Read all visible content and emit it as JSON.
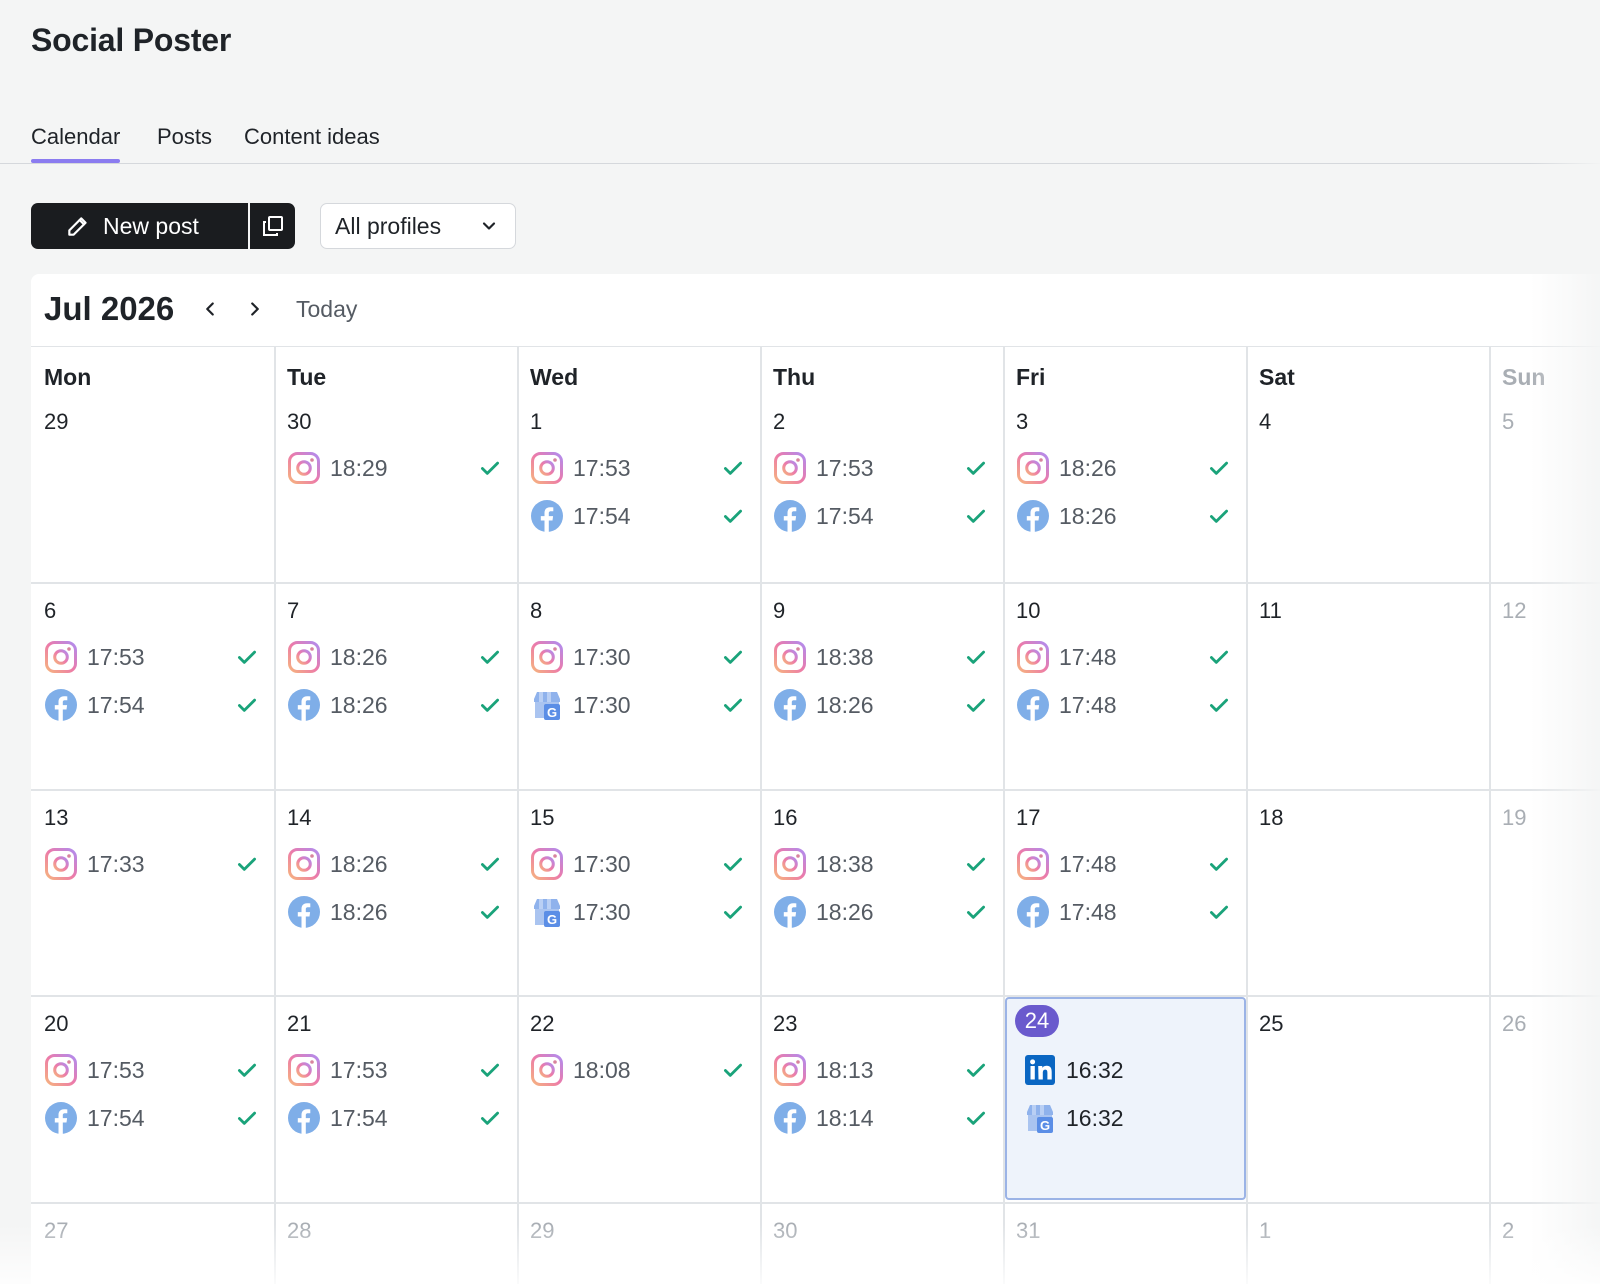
{
  "app": {
    "title": "Social Poster"
  },
  "tabs": [
    {
      "label": "Calendar",
      "active": true
    },
    {
      "label": "Posts",
      "active": false
    },
    {
      "label": "Content ideas",
      "active": false
    }
  ],
  "toolbar": {
    "new_post_label": "New post",
    "profiles_select": "All profiles"
  },
  "calendar": {
    "month_label": "Jul 2026",
    "today_label": "Today",
    "weekdays": [
      "Mon",
      "Tue",
      "Wed",
      "Thu",
      "Fri",
      "Sat",
      "Sun"
    ],
    "weeks": [
      [
        {
          "day": "29",
          "posts": []
        },
        {
          "day": "30",
          "posts": [
            {
              "network": "instagram",
              "time": "18:29",
              "status": "published"
            }
          ]
        },
        {
          "day": "1",
          "posts": [
            {
              "network": "instagram",
              "time": "17:53",
              "status": "published"
            },
            {
              "network": "facebook",
              "time": "17:54",
              "status": "published"
            }
          ]
        },
        {
          "day": "2",
          "posts": [
            {
              "network": "instagram",
              "time": "17:53",
              "status": "published"
            },
            {
              "network": "facebook",
              "time": "17:54",
              "status": "published"
            }
          ]
        },
        {
          "day": "3",
          "posts": [
            {
              "network": "instagram",
              "time": "18:26",
              "status": "published"
            },
            {
              "network": "facebook",
              "time": "18:26",
              "status": "published"
            }
          ]
        },
        {
          "day": "4",
          "posts": []
        },
        {
          "day": "5",
          "posts": []
        }
      ],
      [
        {
          "day": "6",
          "posts": [
            {
              "network": "instagram",
              "time": "17:53",
              "status": "published"
            },
            {
              "network": "facebook",
              "time": "17:54",
              "status": "published"
            }
          ]
        },
        {
          "day": "7",
          "posts": [
            {
              "network": "instagram",
              "time": "18:26",
              "status": "published"
            },
            {
              "network": "facebook",
              "time": "18:26",
              "status": "published"
            }
          ]
        },
        {
          "day": "8",
          "posts": [
            {
              "network": "instagram",
              "time": "17:30",
              "status": "published"
            },
            {
              "network": "google-business",
              "time": "17:30",
              "status": "published"
            }
          ]
        },
        {
          "day": "9",
          "posts": [
            {
              "network": "instagram",
              "time": "18:38",
              "status": "published"
            },
            {
              "network": "facebook",
              "time": "18:26",
              "status": "published"
            }
          ]
        },
        {
          "day": "10",
          "posts": [
            {
              "network": "instagram",
              "time": "17:48",
              "status": "published"
            },
            {
              "network": "facebook",
              "time": "17:48",
              "status": "published"
            }
          ]
        },
        {
          "day": "11",
          "posts": []
        },
        {
          "day": "12",
          "posts": []
        }
      ],
      [
        {
          "day": "13",
          "posts": [
            {
              "network": "instagram",
              "time": "17:33",
              "status": "published"
            }
          ]
        },
        {
          "day": "14",
          "posts": [
            {
              "network": "instagram",
              "time": "18:26",
              "status": "published"
            },
            {
              "network": "facebook",
              "time": "18:26",
              "status": "published"
            }
          ]
        },
        {
          "day": "15",
          "posts": [
            {
              "network": "instagram",
              "time": "17:30",
              "status": "published"
            },
            {
              "network": "google-business",
              "time": "17:30",
              "status": "published"
            }
          ]
        },
        {
          "day": "16",
          "posts": [
            {
              "network": "instagram",
              "time": "18:38",
              "status": "published"
            },
            {
              "network": "facebook",
              "time": "18:26",
              "status": "published"
            }
          ]
        },
        {
          "day": "17",
          "posts": [
            {
              "network": "instagram",
              "time": "17:48",
              "status": "published"
            },
            {
              "network": "facebook",
              "time": "17:48",
              "status": "published"
            }
          ]
        },
        {
          "day": "18",
          "posts": []
        },
        {
          "day": "19",
          "posts": []
        }
      ],
      [
        {
          "day": "20",
          "posts": [
            {
              "network": "instagram",
              "time": "17:53",
              "status": "published"
            },
            {
              "network": "facebook",
              "time": "17:54",
              "status": "published"
            }
          ]
        },
        {
          "day": "21",
          "posts": [
            {
              "network": "instagram",
              "time": "17:53",
              "status": "published"
            },
            {
              "network": "facebook",
              "time": "17:54",
              "status": "published"
            }
          ]
        },
        {
          "day": "22",
          "posts": [
            {
              "network": "instagram",
              "time": "18:08",
              "status": "published"
            }
          ]
        },
        {
          "day": "23",
          "posts": [
            {
              "network": "instagram",
              "time": "18:13",
              "status": "published"
            },
            {
              "network": "facebook",
              "time": "18:14",
              "status": "published"
            }
          ]
        },
        {
          "day": "24",
          "today": true,
          "posts": [
            {
              "network": "linkedin",
              "time": "16:32",
              "status": "scheduled"
            },
            {
              "network": "google-business",
              "time": "16:32",
              "status": "scheduled"
            }
          ]
        },
        {
          "day": "25",
          "posts": []
        },
        {
          "day": "26",
          "posts": []
        }
      ],
      [
        {
          "day": "27",
          "posts": []
        },
        {
          "day": "28",
          "posts": []
        },
        {
          "day": "29",
          "posts": []
        },
        {
          "day": "30",
          "posts": []
        },
        {
          "day": "31",
          "posts": []
        },
        {
          "day": "1",
          "posts": []
        },
        {
          "day": "2",
          "posts": []
        }
      ]
    ]
  },
  "colors": {
    "accent": "#8b7cf0",
    "today_badge": "#6a5acd",
    "check": "#1aa37a",
    "facebook": "#1877f2",
    "linkedin": "#0a66c2"
  }
}
